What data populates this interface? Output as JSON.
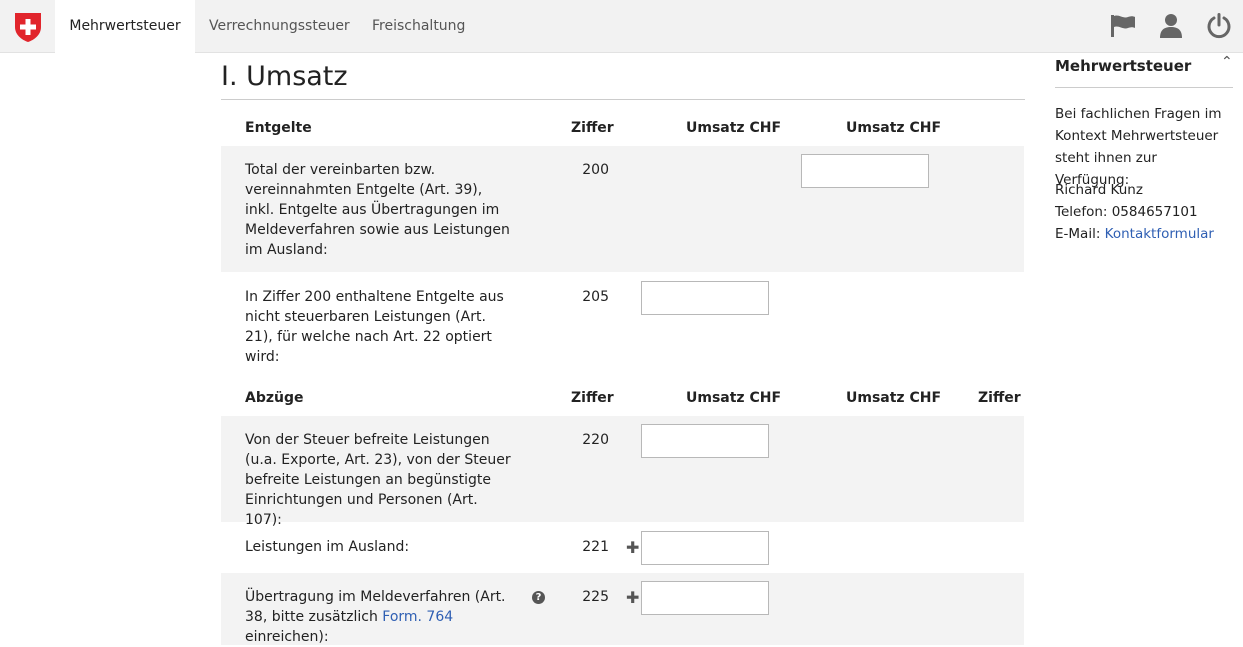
{
  "nav": {
    "tabs": [
      "Mehrwertsteuer",
      "Verrechnungssteuer",
      "Freischaltung"
    ],
    "icons": [
      "flag-icon",
      "user-icon",
      "power-icon"
    ]
  },
  "main": {
    "title": "I. Umsatz",
    "section1": {
      "headers": {
        "label": "Entgelte",
        "ziffer": "Ziffer",
        "umsatz1": "Umsatz CHF",
        "umsatz2": "Umsatz CHF"
      },
      "rows": [
        {
          "text": "Total der vereinbarten bzw. vereinnahmten Entgelte (Art. 39), inkl. Entgelte aus Übertragungen im Meldeverfahren sowie aus Leistungen im Ausland:",
          "ziffer": "200",
          "value": ""
        },
        {
          "text": "In Ziffer 200 enthaltene Entgelte aus nicht steuerbaren Leistungen (Art. 21), für welche nach Art. 22 optiert wird:",
          "ziffer": "205",
          "value": ""
        }
      ]
    },
    "section2": {
      "headers": {
        "label": "Abzüge",
        "ziffer": "Ziffer",
        "umsatz1": "Umsatz CHF",
        "umsatz2": "Umsatz CHF",
        "ziffer2": "Ziffer"
      },
      "rows": [
        {
          "text": "Von der Steuer befreite Leistungen (u.a. Exporte, Art. 23), von der Steuer befreite Leistungen an begünstigte Einrichtungen und Personen (Art. 107):",
          "ziffer": "220",
          "value": ""
        },
        {
          "text": "Leistungen im Ausland:",
          "ziffer": "221",
          "value": ""
        },
        {
          "text_before": "Übertragung im Meldeverfahren (Art. 38, bitte zusätzlich ",
          "link": "Form. 764",
          "text_after": " einreichen):",
          "ziffer": "225",
          "value": ""
        }
      ]
    }
  },
  "sidebar": {
    "title": "Mehrwertsteuer",
    "intro": "Bei fachlichen Fragen im Kontext Mehrwertsteuer steht ihnen zur Verfügung:",
    "name": "Richard Kunz",
    "phone": "Telefon: 0584657101",
    "email_label": "E-Mail: ",
    "email_link": "Kontaktformular"
  },
  "colors": {
    "link": "#2f5fb3",
    "band": "#f3f3f3",
    "logo_red": "#e1252c"
  }
}
